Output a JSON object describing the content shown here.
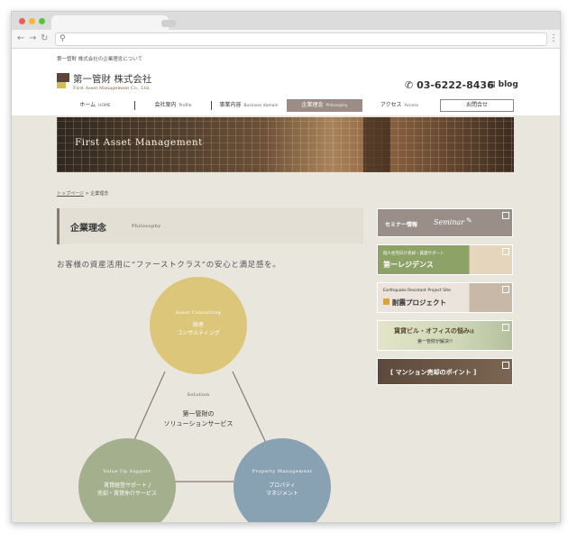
{
  "header": {
    "tagline": "第一管財 株式会社の企業理念について",
    "company_jp": "第一管財 株式会社",
    "company_en": "First Asset Management Co., Ltd.",
    "phone": "03-6222-8436",
    "blog": "blog"
  },
  "nav": {
    "items": [
      {
        "jp": "ホーム",
        "en": "HOME"
      },
      {
        "jp": "会社案内",
        "en": "Profile"
      },
      {
        "jp": "事業内容",
        "en": "Business domain"
      },
      {
        "jp": "企業理念",
        "en": "Philosophy"
      },
      {
        "jp": "アクセス",
        "en": "Access"
      }
    ],
    "contact": "お問合せ"
  },
  "hero": {
    "title": "First Asset Management"
  },
  "breadcrumb": {
    "home": "トップページ",
    "sep": ">",
    "current": "企業理念"
  },
  "page_title": {
    "jp": "企業理念",
    "en": "Philosophy"
  },
  "lead": "お客様の資産活用に“ファーストクラス”の安心と満足感を。",
  "diagram": {
    "center_en": "Solution",
    "center_jp_1": "第一管財の",
    "center_jp_2": "ソリューションサービス",
    "top": {
      "en": "Asset Consulting",
      "jp1": "財産",
      "jp2": "コンサルティング",
      "color": "#dcc67a"
    },
    "left": {
      "en": "Value Up Support",
      "jp1": "賃貸経営サポート /",
      "jp2": "売却・賃貸仲介サービス",
      "color": "#a4af8e"
    },
    "right": {
      "en": "Property Management",
      "jp1": "プロパティ",
      "jp2": "マネジメント",
      "color": "#88a1b3"
    }
  },
  "sidebar": {
    "seminar": {
      "jp": "セミナー情報",
      "en": "Seminar"
    },
    "residence": {
      "small": "個人住宅向け売却・賃貸サポート",
      "title": "第一レジデンス"
    },
    "quake": {
      "small": "Earthquake Resistant Project Site",
      "title": "耐震プロジェクト"
    },
    "trouble": {
      "line1": "賃貸ビル・オフィスの悩み",
      "suffix": "は",
      "line2": "第一管財が解決!!"
    },
    "mansion": {
      "title": "マンション売却のポイント"
    }
  }
}
